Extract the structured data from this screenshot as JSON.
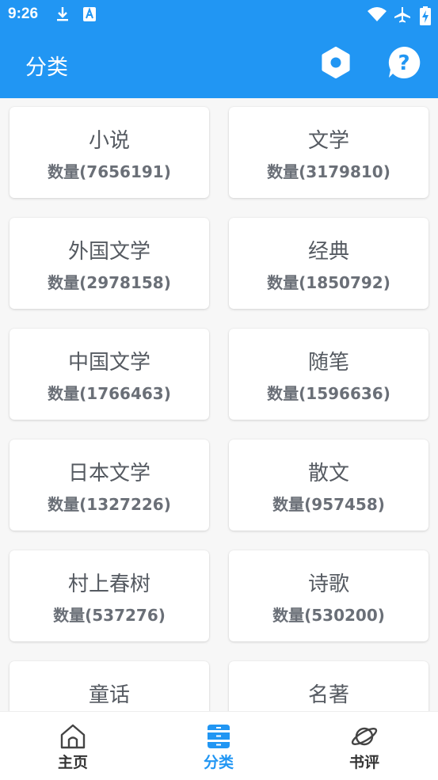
{
  "status_bar": {
    "time": "9:26",
    "icons": [
      "download-icon",
      "a-badge-icon",
      "wifi-icon",
      "airplane-icon",
      "battery-charging-icon"
    ]
  },
  "app_bar": {
    "title": "分类",
    "actions": [
      "settings-icon",
      "help-icon"
    ]
  },
  "categories": [
    {
      "name": "小说",
      "count": "数量(7656191)"
    },
    {
      "name": "文学",
      "count": "数量(3179810)"
    },
    {
      "name": "外国文学",
      "count": "数量(2978158)"
    },
    {
      "name": "经典",
      "count": "数量(1850792)"
    },
    {
      "name": "中国文学",
      "count": "数量(1766463)"
    },
    {
      "name": "随笔",
      "count": "数量(1596636)"
    },
    {
      "name": "日本文学",
      "count": "数量(1327226)"
    },
    {
      "name": "散文",
      "count": "数量(957458)"
    },
    {
      "name": "村上春树",
      "count": "数量(537276)"
    },
    {
      "name": "诗歌",
      "count": "数量(530200)"
    },
    {
      "name": "童话",
      "count": ""
    },
    {
      "name": "名著",
      "count": ""
    }
  ],
  "bottom_nav": {
    "items": [
      {
        "label": "主页",
        "icon": "home-icon"
      },
      {
        "label": "分类",
        "icon": "category-icon"
      },
      {
        "label": "书评",
        "icon": "planet-icon"
      }
    ],
    "active_index": 1
  },
  "colors": {
    "primary": "#2196f3",
    "card_text": "#555a61",
    "nav_text": "#333333",
    "background": "#f7f7f7"
  }
}
